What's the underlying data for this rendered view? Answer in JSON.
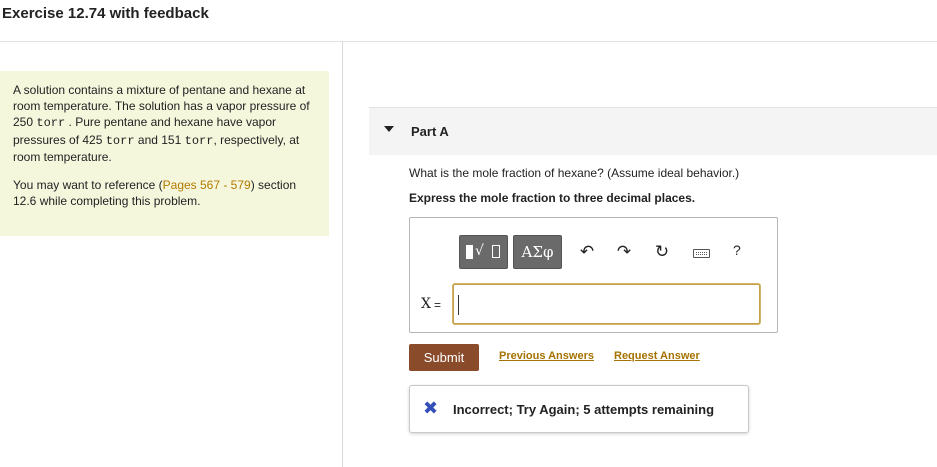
{
  "header": {
    "title": "Exercise 12.74 with feedback"
  },
  "problem": {
    "p1_a": "A solution contains a mixture of pentane and hexane at room temperature. The solution has a vapor pressure of 250",
    "p1_unit1": "torr",
    "p1_b": ". Pure pentane and hexane have vapor pressures of 425",
    "p1_unit2": "torr",
    "p1_c": "and 151",
    "p1_unit3": "torr",
    "p1_d": ", respectively, at room temperature.",
    "p2_a": "You may want to reference (",
    "p2_link": "Pages 567 - 579",
    "p2_b": ") section 12.6 while completing this problem."
  },
  "part": {
    "title": "Part A",
    "question": "What is the mole fraction of hexane? (Assume ideal behavior.)",
    "instruction": "Express the mole fraction to three decimal places."
  },
  "toolbar": {
    "greek_label": "ΑΣφ",
    "undo_glyph": "↶",
    "redo_glyph": "↷",
    "reset_glyph": "↻",
    "help_label": "?",
    "icons": [
      "templates-icon",
      "greek-letters-icon",
      "undo-icon",
      "redo-icon",
      "reset-icon",
      "keyboard-icon",
      "help-icon"
    ]
  },
  "answer": {
    "variable": "X",
    "equals": "=",
    "value": ""
  },
  "actions": {
    "submit_label": "Submit",
    "previous_answers": "Previous Answers",
    "request_answer": "Request Answer"
  },
  "feedback": {
    "icon": "x-mark-icon",
    "mark": "✖",
    "text": "Incorrect; Try Again; 5 attempts remaining"
  },
  "colors": {
    "problem_bg": "#f5f7dd",
    "link": "#b37a00",
    "submit_bg": "#8a4b2a",
    "error_icon": "#3450b8"
  }
}
